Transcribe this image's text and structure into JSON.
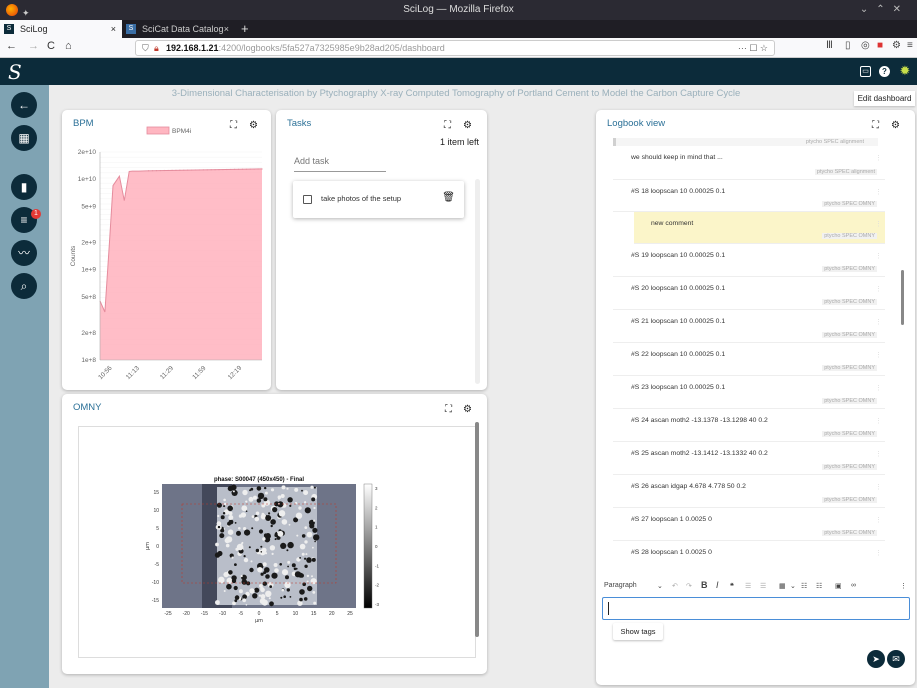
{
  "window": {
    "title": "SciLog — Mozilla Firefox"
  },
  "tabs": [
    {
      "label": "SciLog",
      "close": "×"
    },
    {
      "label": "SciCat Data Catalog User Man",
      "close": "×"
    }
  ],
  "newtab": "+",
  "nav": {
    "back": "←",
    "forward": "→",
    "reload": "C",
    "home": "⌂",
    "url_host": "192.168.1.21",
    "url_path": ":4200/logbooks/5fa527a7325985e9b28ad205/dashboard",
    "url_actions": "··· ☐ ☆"
  },
  "app": {
    "logo": "S"
  },
  "project_title": "3-Dimensional Characterisation by Ptychography X-ray Computed Tomography of Portland Cement to Model the Carbon Capture Cycle",
  "edit_dashboard": "Edit dashboard",
  "sidebar": {
    "notification_count": "1"
  },
  "bpm": {
    "title": "BPM",
    "chart_data": {
      "type": "area",
      "legend": [
        "BPM4i"
      ],
      "ylabel": "Counts",
      "yscale": "log",
      "ylim": [
        100000000,
        20000000000
      ],
      "yticks": [
        "2e+10",
        "1e+10",
        "5e+9",
        "2e+9",
        "1e+9",
        "5e+8",
        "2e+8",
        "1e+8"
      ],
      "xticks": [
        "10:56",
        "11:13",
        "11:29",
        "11:59",
        "12:19"
      ],
      "x": [
        0,
        0.03,
        0.06,
        0.08,
        0.12,
        0.15,
        0.18,
        0.2,
        0.24,
        0.28,
        0.32,
        1
      ],
      "y": [
        450000000,
        340000000,
        2200000000,
        8500000000,
        10800000000,
        5800000000,
        12200000000,
        12300000000,
        12300000000,
        12350000000,
        12400000000,
        13000000000
      ],
      "color": "#ffb6c1"
    }
  },
  "tasks": {
    "title": "Tasks",
    "items_left": "1 item left",
    "add_placeholder": "Add task",
    "items": [
      {
        "label": "take photos of the setup",
        "done": false
      }
    ]
  },
  "omny": {
    "title": "OMNY",
    "chart_data": {
      "type": "heatmap",
      "title": "phase: S00047 (450x450) - Final",
      "xlabel": "μm",
      "ylabel": "μm",
      "xticks": [
        "-25",
        "-20",
        "-15",
        "-10",
        "-5",
        "0",
        "5",
        "10",
        "15",
        "20",
        "25"
      ],
      "yticks": [
        "15",
        "10",
        "5",
        "0",
        "-5",
        "-10",
        "-15"
      ],
      "colorbar_ticks": [
        "3",
        "2",
        "1",
        "0",
        "-1",
        "-2",
        "-3"
      ]
    }
  },
  "logbook": {
    "title": "Logbook view",
    "top_tags": "ptycho SPEC alignment",
    "entries": [
      {
        "text": "we should keep in mind that ...",
        "tags": "ptycho SPEC alignment"
      },
      {
        "text": "#S 18 loopscan 10 0.00025 0.1",
        "tags": "ptycho SPEC OMNY"
      },
      {
        "text": "new comment",
        "tags": "ptycho SPEC OMNY",
        "comment": true
      },
      {
        "text": "#S 19 loopscan 10 0.00025 0.1",
        "tags": "ptycho SPEC OMNY"
      },
      {
        "text": "#S 20 loopscan 10 0.00025 0.1",
        "tags": "ptycho SPEC OMNY"
      },
      {
        "text": "#S 21 loopscan 10 0.00025 0.1",
        "tags": "ptycho SPEC OMNY"
      },
      {
        "text": "#S 22 loopscan 10 0.00025 0.1",
        "tags": "ptycho SPEC OMNY"
      },
      {
        "text": "#S 23 loopscan 10 0.00025 0.1",
        "tags": "ptycho SPEC OMNY"
      },
      {
        "text": "#S 24 ascan moth2 -13.1378 -13.1298 40 0.2",
        "tags": "ptycho SPEC OMNY"
      },
      {
        "text": "#S 25 ascan moth2 -13.1412 -13.1332 40 0.2",
        "tags": "ptycho SPEC OMNY"
      },
      {
        "text": "#S 26 ascan idgap 4.678 4.778 50 0.2",
        "tags": "ptycho SPEC OMNY"
      },
      {
        "text": "#S 27 loopscan 1 0.0025 0",
        "tags": "ptycho SPEC OMNY"
      },
      {
        "text": "#S 28 loopscan 1 0.0025 0",
        "tags": "ptycho SPEC OMNY"
      }
    ],
    "editor": {
      "paragraph": "Paragraph",
      "show_tags": "Show tags"
    }
  }
}
